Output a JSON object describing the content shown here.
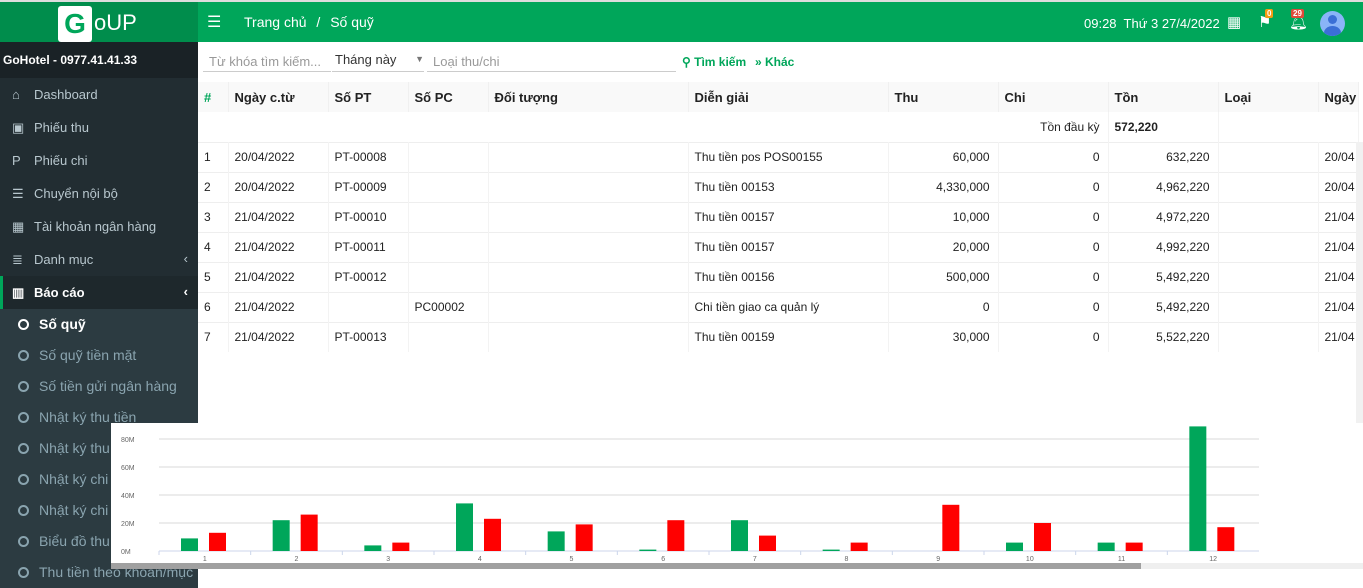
{
  "brand": {
    "logo_letter": "G",
    "logo_rest": "oUP"
  },
  "header": {
    "breadcrumb": [
      "Trang chủ",
      "/",
      "Số quỹ"
    ],
    "clock": "09:28  Thứ 3 27/4/2022",
    "flag_badge": "0",
    "bell_badge": "29"
  },
  "sidebar": {
    "hotel": "GoHotel - 0977.41.41.33",
    "items": [
      {
        "label": "Dashboard",
        "icon": "home-icon",
        "glyph": "⌂"
      },
      {
        "label": "Phiếu thu",
        "icon": "money-icon",
        "glyph": "▣"
      },
      {
        "label": "Phiếu chi",
        "icon": "paypal-icon",
        "glyph": "P"
      },
      {
        "label": "Chuyển nội bộ",
        "icon": "sliders-icon",
        "glyph": "☰"
      },
      {
        "label": "Tài khoản ngân hàng",
        "icon": "building-icon",
        "glyph": "▦"
      },
      {
        "label": "Danh mục",
        "icon": "list-icon",
        "glyph": "≣"
      },
      {
        "label": "Báo cáo",
        "icon": "bar-chart-icon",
        "glyph": "▥"
      }
    ],
    "subitems": [
      "Số quỹ",
      "Số quỹ tiền mặt",
      "Số tiền gửi ngân hàng",
      "Nhật ký thu tiền",
      "Nhật ký thu",
      "Nhật ký chi",
      "Nhật ký chi",
      "Biểu đồ thu",
      "Thu tiền theo khoản/mục"
    ]
  },
  "filter": {
    "keyword_placeholder": "Từ khóa tìm kiếm...",
    "period": "Tháng này",
    "type_placeholder": "Loại thu/chi",
    "search": "Tìm kiếm",
    "more": "Khác"
  },
  "table": {
    "headers": [
      "#",
      "Ngày c.từ",
      "Số PT",
      "Số PC",
      "Đối tượng",
      "Diễn giải",
      "Thu",
      "Chi",
      "Tồn",
      "Loại",
      "Ngày g"
    ],
    "opening_label": "Tồn đầu kỳ",
    "opening_value": "572,220",
    "rows": [
      [
        "1",
        "20/04/2022",
        "PT-00008",
        "",
        "",
        "Thu tiền pos POS00155",
        "60,000",
        "0",
        "632,220",
        "",
        "20/04"
      ],
      [
        "2",
        "20/04/2022",
        "PT-00009",
        "",
        "",
        "Thu tiền 00153",
        "4,330,000",
        "0",
        "4,962,220",
        "",
        "20/04"
      ],
      [
        "3",
        "21/04/2022",
        "PT-00010",
        "",
        "",
        "Thu tiền 00157",
        "10,000",
        "0",
        "4,972,220",
        "",
        "21/04"
      ],
      [
        "4",
        "21/04/2022",
        "PT-00011",
        "",
        "",
        "Thu tiền 00157",
        "20,000",
        "0",
        "4,992,220",
        "",
        "21/04"
      ],
      [
        "5",
        "21/04/2022",
        "PT-00012",
        "",
        "",
        "Thu tiền 00156",
        "500,000",
        "0",
        "5,492,220",
        "",
        "21/04"
      ],
      [
        "6",
        "21/04/2022",
        "",
        "PC00002",
        "",
        "Chi tiền giao ca quản lý",
        "0",
        "0",
        "5,492,220",
        "",
        "21/04"
      ],
      [
        "7",
        "21/04/2022",
        "PT-00013",
        "",
        "",
        "Thu tiền 00159",
        "30,000",
        "0",
        "5,522,220",
        "",
        "21/04"
      ]
    ]
  },
  "chart_data": {
    "type": "bar",
    "categories": [
      "1",
      "2",
      "3",
      "4",
      "5",
      "6",
      "7",
      "8",
      "9",
      "10",
      "11",
      "12"
    ],
    "yticks": [
      "0M",
      "20M",
      "40M",
      "60M",
      "80M"
    ],
    "ylim": [
      0,
      80
    ],
    "colors": {
      "thu": "#00a65a",
      "chi": "#ff0000"
    },
    "series": [
      {
        "values": [
          9,
          22,
          4,
          34,
          14,
          1,
          22,
          1,
          0,
          6,
          6,
          89
        ]
      },
      {
        "values": [
          13,
          26,
          6,
          23,
          19,
          22,
          11,
          6,
          33,
          20,
          6,
          17
        ]
      }
    ]
  }
}
